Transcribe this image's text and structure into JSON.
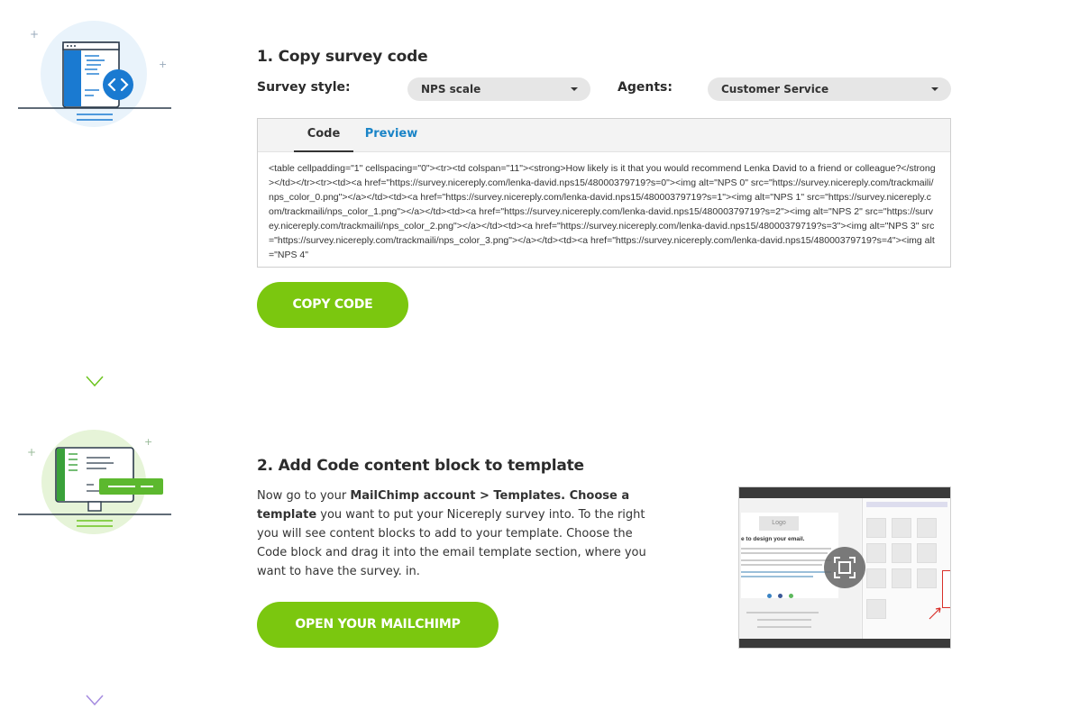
{
  "step1": {
    "title": "1. Copy survey code",
    "survey_style_label": "Survey style:",
    "survey_style_value": "NPS scale",
    "agents_label": "Agents:",
    "agents_value": "Customer Service",
    "tabs": [
      "Code",
      "Preview"
    ],
    "code": "<table cellpadding=\"1\" cellspacing=\"0\"><tr><td colspan=\"11\"><strong>How likely is it that you would recommend Lenka David to a friend or colleague?</strong></td></tr><tr><td><a href=\"https://survey.nicereply.com/lenka-david.nps15/48000379719?s=0\"><img alt=\"NPS 0\" src=\"https://survey.nicereply.com/trackmaili/nps_color_0.png\"></a></td><td><a href=\"https://survey.nicereply.com/lenka-david.nps15/48000379719?s=1\"><img alt=\"NPS 1\" src=\"https://survey.nicereply.com/trackmaili/nps_color_1.png\"></a></td><td><a href=\"https://survey.nicereply.com/lenka-david.nps15/48000379719?s=2\"><img alt=\"NPS 2\" src=\"https://survey.nicereply.com/trackmaili/nps_color_2.png\"></a></td><td><a href=\"https://survey.nicereply.com/lenka-david.nps15/48000379719?s=3\"><img alt=\"NPS 3\" src=\"https://survey.nicereply.com/trackmaili/nps_color_3.png\"></a></td><td><a href=\"https://survey.nicereply.com/lenka-david.nps15/48000379719?s=4\"><img alt=\"NPS 4\"",
    "copy_button": "COPY CODE"
  },
  "step2": {
    "title": "2. Add Code content block to template",
    "para_1": "Now go to your ",
    "para_bold_1": "MailChimp account > Templates. Choose a template",
    "para_2": " you want to put your Nicereply survey into. To the right you will see content blocks to add to your template. Choose the Code block and drag it into the email template section, where you want to have the survey. in.",
    "open_button": "OPEN YOUR MAILCHIMP",
    "thumbnail": {
      "logo": "Logo",
      "heading": "e to design your email."
    }
  },
  "icons": [
    "code-window-icon",
    "monitor-icon",
    "expand-icon",
    "dropdown-caret-icon"
  ],
  "colors": {
    "accent_green": "#7bc70f",
    "link_blue": "#1a84c7",
    "timeline_top": "#1a6fb0",
    "timeline_mid": "#6cc41e",
    "timeline_bottom": "#a58be0"
  }
}
